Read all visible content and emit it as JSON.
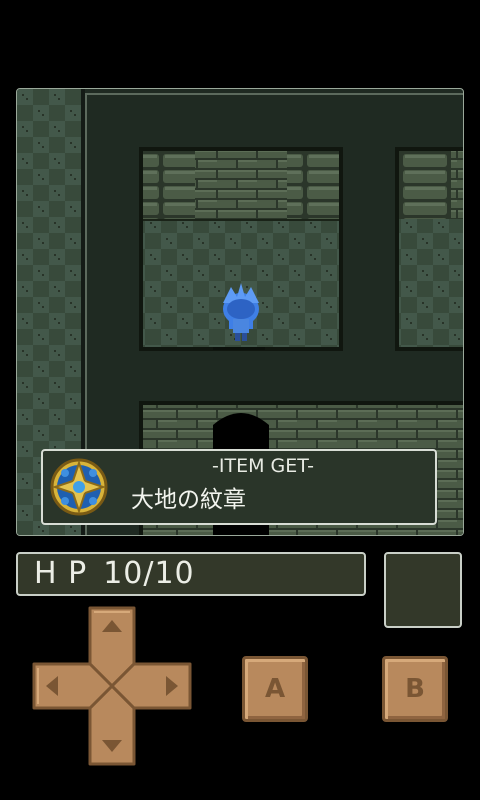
{
  "dialog": {
    "header": "-ITEM GET-",
    "item_name": "大地の紋章",
    "item_icon": "emblem-icon"
  },
  "status": {
    "hp_label": "H P",
    "hp_value": "10/10"
  },
  "controls": {
    "a_label": "A",
    "b_label": "B"
  },
  "colors": {
    "floor_dark": "#1f2a22",
    "brick": "#4a5a45",
    "brick_mortar": "#2c372a",
    "checker_light": "#3e5140",
    "checker_dark": "#34453a",
    "player_blue": "#3f7fe6",
    "button_tan": "#b8895d"
  }
}
